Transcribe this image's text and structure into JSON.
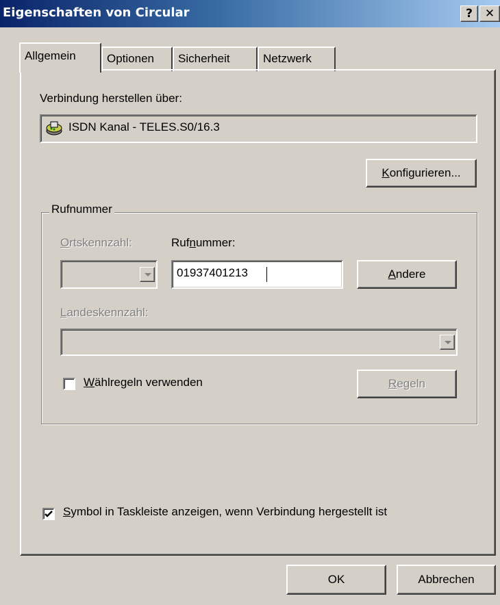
{
  "window": {
    "title": "Eigenschaften von Circular",
    "help_label": "?",
    "close_label": "✕"
  },
  "tabs": [
    {
      "label": "Allgemein",
      "active": true
    },
    {
      "label": "Optionen",
      "active": false
    },
    {
      "label": "Sicherheit",
      "active": false
    },
    {
      "label": "Netzwerk",
      "active": false
    }
  ],
  "connection": {
    "label": "Verbindung herstellen über:",
    "device": "ISDN  Kanal - TELES.S0/16.3",
    "device_icon": "modem-icon",
    "configure_label_prefix": "K",
    "configure_label_rest": "onfigurieren..."
  },
  "phone": {
    "group_title": "Rufnummer",
    "area_code_label_prefix": "O",
    "area_code_label_rest": "rtskennzahl:",
    "number_label_pre": "Ruf",
    "number_label_u": "n",
    "number_label_post": "ummer:",
    "number_value": "01937401213",
    "other_button_prefix": "A",
    "other_button_rest": "ndere",
    "country_code_label_prefix": "L",
    "country_code_label_rest": "andeskennzahl:",
    "dial_rules_prefix": "W",
    "dial_rules_rest": "ählregeln verwenden",
    "dial_rules_checked": false,
    "rules_button_prefix": "R",
    "rules_button_rest": "egeln"
  },
  "tray": {
    "label_prefix": "S",
    "label_rest": "ymbol in Taskleiste anzeigen, wenn Verbindung hergestellt ist",
    "checked": true
  },
  "footer": {
    "ok_label": "OK",
    "cancel_label": "Abbrechen"
  }
}
